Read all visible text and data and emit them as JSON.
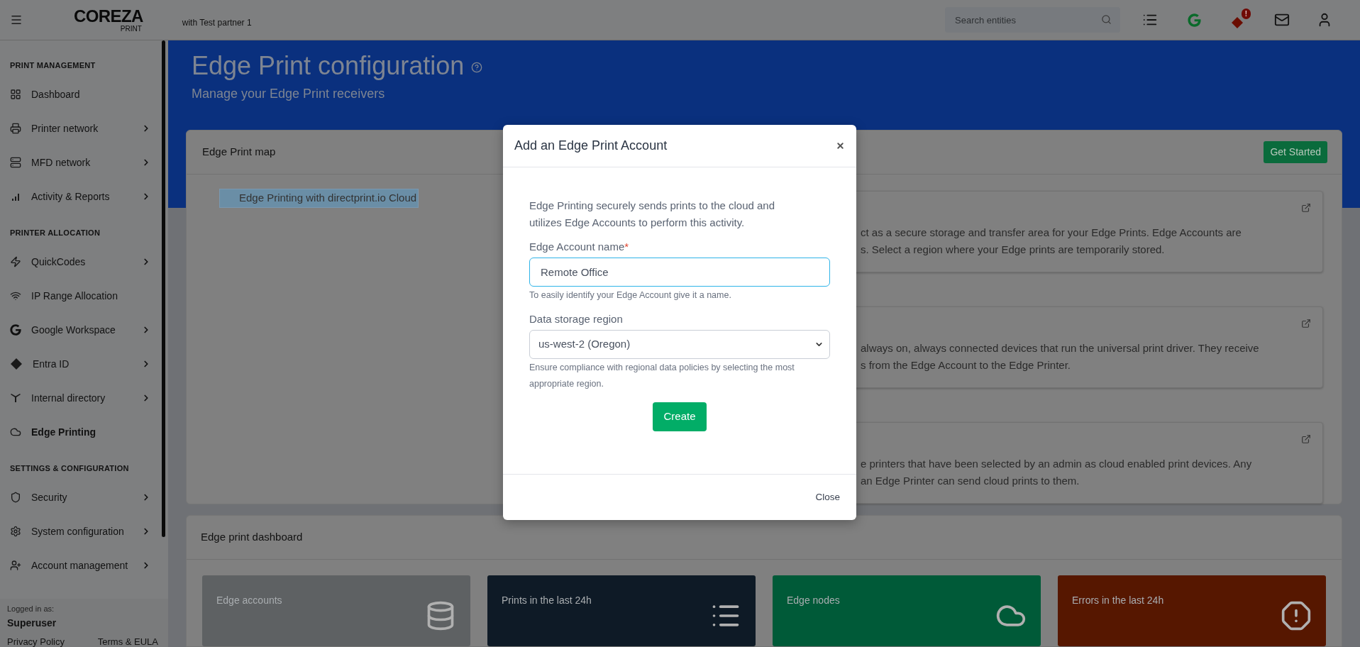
{
  "top_bar": {
    "logo": "COREZA",
    "logo_sub": "PRINT",
    "partner": "with Test partner 1",
    "search": {
      "placeholder": "Search entities"
    },
    "alert_badge": "!"
  },
  "sidebar": {
    "sections": [
      {
        "title": "PRINT MANAGEMENT",
        "items": [
          {
            "label": "Dashboard",
            "has_submenu": false,
            "selected": false
          },
          {
            "label": "Printer network",
            "has_submenu": true,
            "selected": false
          },
          {
            "label": "MFD network",
            "has_submenu": true,
            "selected": false
          },
          {
            "label": "Activity & Reports",
            "has_submenu": true,
            "selected": false
          }
        ]
      },
      {
        "title": "PRINTER ALLOCATION",
        "items": [
          {
            "label": "QuickCodes",
            "has_submenu": true,
            "selected": false
          },
          {
            "label": "IP Range Allocation",
            "has_submenu": false,
            "selected": false
          },
          {
            "label": "Google Workspace",
            "has_submenu": true,
            "selected": false
          },
          {
            "label": "Entra ID",
            "has_submenu": true,
            "selected": false
          },
          {
            "label": "Internal directory",
            "has_submenu": true,
            "selected": false
          },
          {
            "label": "Edge Printing",
            "has_submenu": false,
            "selected": true
          }
        ]
      },
      {
        "title": "SETTINGS & CONFIGURATION",
        "items": [
          {
            "label": "Security",
            "has_submenu": true,
            "selected": false
          },
          {
            "label": "System configuration",
            "has_submenu": true,
            "selected": false
          },
          {
            "label": "Account management",
            "has_submenu": true,
            "selected": false
          }
        ]
      }
    ],
    "footer": {
      "logged_in_label": "Logged in as:",
      "user": "Superuser",
      "links": [
        "Privacy Policy",
        "Terms & EULA"
      ]
    }
  },
  "header": {
    "title": "Edge Print configuration",
    "subtitle": "Manage your Edge Print receivers"
  },
  "map_card": {
    "title": "Edge Print map",
    "nodes": [
      {
        "label": "Edge Printing with directprint.io Cloud",
        "selected": true
      }
    ]
  },
  "guide_card": {
    "button": "Get Started",
    "boxes": [
      {
        "lines": [
          "ct as a secure storage and transfer area for your Edge Prints. Edge Accounts are",
          "s. Select a region where your Edge prints are temporarily stored."
        ]
      },
      {
        "lines": [
          "always on, always connected devices that run the universal print driver. They receive",
          "s from the Edge Account to the Edge Printer."
        ]
      },
      {
        "lines": [
          "e printers that have been selected by an admin as cloud enabled print devices. Any",
          "an Edge Printer can send cloud prints to them."
        ]
      }
    ]
  },
  "dashboard": {
    "title": "Edge print dashboard",
    "tiles": [
      {
        "label": "Edge accounts",
        "color": "#5e6163"
      },
      {
        "label": "Prints in the last 24h",
        "color": "#0e1a26"
      },
      {
        "label": "Edge nodes",
        "color": "#005a38"
      },
      {
        "label": "Errors in the last 24h",
        "color": "#561700"
      }
    ]
  },
  "modal": {
    "title": "Add an Edge Print Account",
    "intro": "Edge Printing securely sends prints to the cloud and utilizes Edge Accounts to perform this activity.",
    "fields": [
      {
        "kind": "text",
        "label": "Edge Account name",
        "required_mark": "*",
        "value": "Remote Office",
        "focused": true,
        "help": "To easily identify your Edge Account give it a name."
      },
      {
        "kind": "select",
        "label": "Data storage region",
        "value": "us-west-2 (Oregon)",
        "focused": false,
        "help": "Ensure compliance with regional data policies by selecting the most appropriate region."
      }
    ],
    "primary_button": "Create",
    "footer_button": "Close"
  }
}
